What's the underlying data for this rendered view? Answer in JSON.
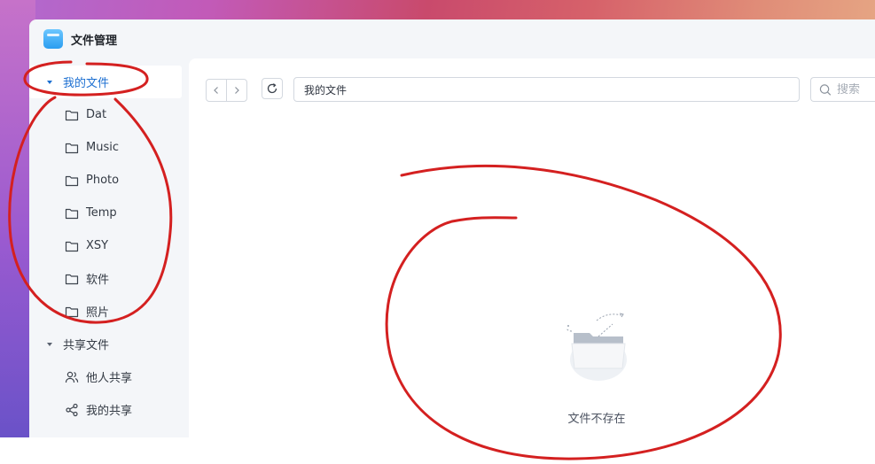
{
  "app": {
    "title": "文件管理",
    "icon": "file-manager-app-icon"
  },
  "sidebar": {
    "my_files": {
      "label": "我的文件",
      "expanded": true,
      "active": true
    },
    "folders": [
      {
        "label": "Dat"
      },
      {
        "label": "Music"
      },
      {
        "label": "Photo"
      },
      {
        "label": "Temp"
      },
      {
        "label": "XSY"
      },
      {
        "label": "软件"
      },
      {
        "label": "照片"
      }
    ],
    "shared_files": {
      "label": "共享文件",
      "expanded": true
    },
    "shared_items": [
      {
        "label": "他人共享",
        "icon": "users-icon"
      },
      {
        "label": "我的共享",
        "icon": "share-icon"
      }
    ]
  },
  "toolbar": {
    "path": "我的文件",
    "search_placeholder": "搜索"
  },
  "main": {
    "empty_message": "文件不存在"
  },
  "colors": {
    "accent": "#1c6fd1",
    "annotation": "#d42020",
    "sidebar_bg": "#f4f6f9"
  }
}
